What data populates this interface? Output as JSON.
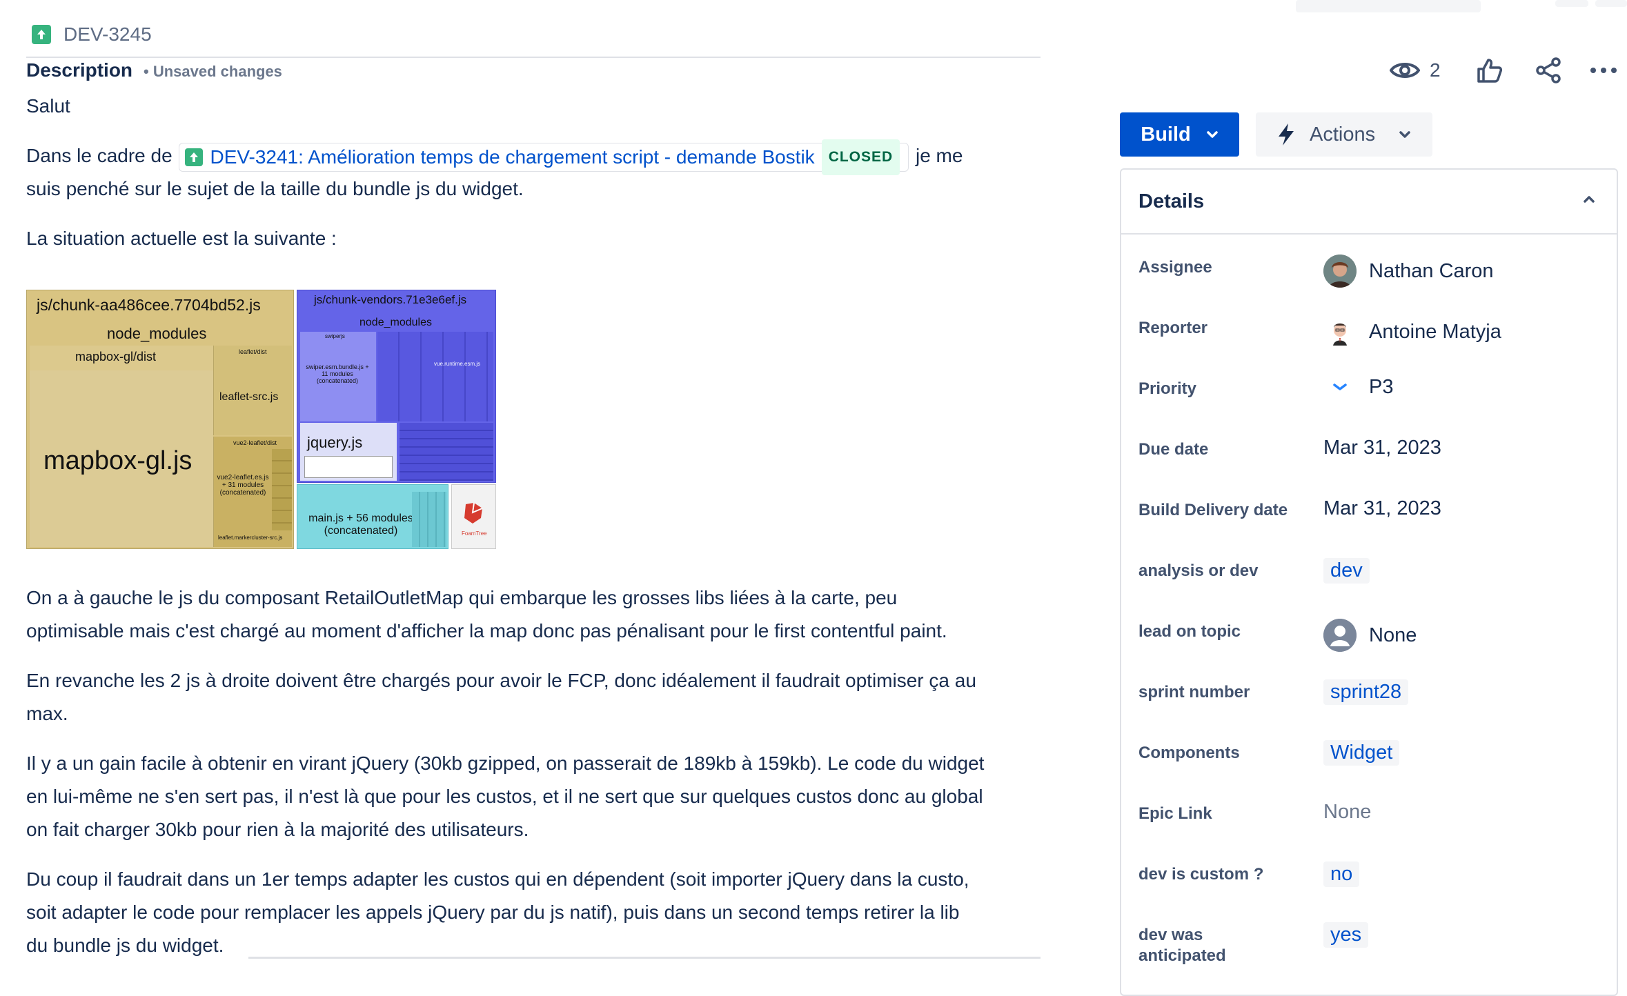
{
  "issue": {
    "key": "DEV-3245"
  },
  "description": {
    "title": "Description",
    "status": "• Unsaved changes",
    "greeting": "Salut",
    "p1_before": "Dans le cadre de",
    "linked_issue": {
      "text": "DEV-3241: Amélioration temps de chargement script - demande Bostik",
      "status": "CLOSED"
    },
    "p1_after": "je me",
    "p1_line2": "suis penché sur le sujet de la taille du bundle js du widget.",
    "p2": "La situation actuelle est la suivante :",
    "p3_line1": "On a à gauche le js du composant RetailOutletMap qui embarque les grosses libs liées à la carte, peu",
    "p3_line2": "optimisable mais c'est chargé au moment d'afficher la map donc pas pénalisant pour le first contentful paint.",
    "p4_line1": "En revanche les 2 js à droite doivent être chargés pour avoir le FCP, donc idéalement il faudrait optimiser ça au",
    "p4_line2": "max.",
    "p5_line1": "Il y a un gain facile à obtenir en virant jQuery (30kb gzipped, on passerait de 189kb à 159kb). Le code du widget",
    "p5_line2": "en lui-même ne s'en sert pas, il n'est là que pour les custos, et il ne sert que sur quelques custos donc au global",
    "p5_line3": "on fait charger 30kb pour rien à la majorité des utilisateurs.",
    "p6_line1": "Du coup il faudrait dans un 1er temps adapter les custos qui en dépendent (soit importer jQuery dans la custo,",
    "p6_line2": "soit adapter le code pour remplacer les appels jQuery par du js natif), puis dans un second temps retirer la lib",
    "p6_line3": "du bundle js du widget."
  },
  "treemap": {
    "left_chunk": "js/chunk-aa486cee.7704bd52.js",
    "left_node_modules": "node_modules",
    "mapbox_dist": "mapbox-gl/dist",
    "mapbox": "mapbox-gl.js",
    "leaflet_dist": "leaflet/dist",
    "leaflet_src": "leaflet-src.js",
    "vue2_leaflet_dist": "vue2-leaflet/dist",
    "vue2_leaflet": "vue2-leaflet.es.js + 31 modules (concatenated)",
    "markercluster": "leaflet.markercluster-src.js",
    "right_chunk": "js/chunk-vendors.71e3e6ef.js",
    "right_node_modules": "node_modules",
    "swiperjs": "swiperjs",
    "swiper": "swiper.esm.bundle.js + 11 modules (concatenated)",
    "vue_runtime": "vue.runtime.esm.js",
    "jquery": "jquery.js",
    "main": "main.js + 56 modules (concatenated)",
    "foamtree": "FoamTree"
  },
  "header": {
    "watch_count": "2"
  },
  "buttons": {
    "build": "Build",
    "actions": "Actions"
  },
  "details": {
    "title": "Details",
    "fields": [
      {
        "label": "Assignee",
        "value": "Nathan Caron"
      },
      {
        "label": "Reporter",
        "value": "Antoine Matyja"
      },
      {
        "label": "Priority",
        "value": "P3"
      },
      {
        "label": "Due date",
        "value": "Mar 31, 2023"
      },
      {
        "label": "Build Delivery date",
        "value": "Mar 31, 2023"
      },
      {
        "label": "analysis or dev",
        "value": "dev"
      },
      {
        "label": "lead on topic",
        "value": "None"
      },
      {
        "label": "sprint number",
        "value": "sprint28"
      },
      {
        "label": "Components",
        "value": "Widget"
      },
      {
        "label": "Epic Link",
        "value": "None"
      },
      {
        "label": "dev is custom ?",
        "value": "no"
      },
      {
        "label": "dev was anticipated",
        "value": "yes"
      }
    ]
  },
  "colors": {
    "primary": "#0052cc",
    "story": "#36b37e",
    "closed_bg": "#e3fcef",
    "closed_text": "#006644"
  }
}
